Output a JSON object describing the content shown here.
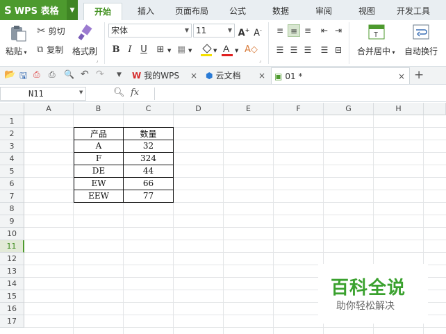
{
  "app": {
    "name": "WPS 表格",
    "logo": "S"
  },
  "menu_tabs": [
    "开始",
    "插入",
    "页面布局",
    "公式",
    "数据",
    "审阅",
    "视图",
    "开发工具"
  ],
  "ribbon": {
    "paste": "粘贴",
    "cut": "剪切",
    "copy": "复制",
    "format_painter": "格式刷",
    "font_name": "宋体",
    "font_size": "11",
    "merge_center": "合并居中",
    "auto_wrap": "自动换行"
  },
  "doc_tabs": [
    {
      "label": "我的WPS"
    },
    {
      "label": "云文档"
    },
    {
      "label": "01 *"
    }
  ],
  "formula_bar": {
    "name_box": "N11",
    "fx": "fx",
    "formula": ""
  },
  "columns": [
    "A",
    "B",
    "C",
    "D",
    "E",
    "F",
    "G",
    "H"
  ],
  "rows": [
    "1",
    "2",
    "3",
    "4",
    "5",
    "6",
    "7",
    "8",
    "9",
    "10",
    "11",
    "12",
    "13",
    "14",
    "15",
    "16",
    "17"
  ],
  "selected_row": "11",
  "table": {
    "headers": [
      "产品",
      "数量"
    ],
    "rows": [
      [
        "A",
        "32"
      ],
      [
        "F",
        "324"
      ],
      [
        "DE",
        "44"
      ],
      [
        "EW",
        "66"
      ],
      [
        "EEW",
        "77"
      ]
    ]
  },
  "watermark": {
    "title": "百科全说",
    "subtitle": "助你轻松解决"
  },
  "colors": {
    "accent": "#4d9a2e",
    "watermark_green": "#3aa12e"
  }
}
